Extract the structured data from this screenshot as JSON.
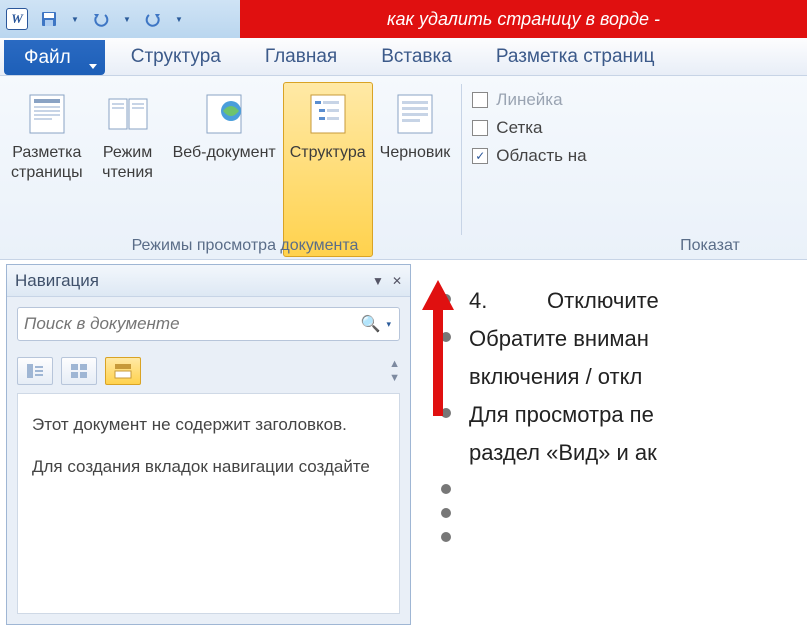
{
  "titlebar": {
    "title": "как удалить страницу в ворде -"
  },
  "tabs": {
    "file": "Файл",
    "items": [
      "Структура",
      "Главная",
      "Вставка",
      "Разметка страниц"
    ]
  },
  "ribbon": {
    "views": [
      {
        "key": "page-layout",
        "label": "Разметка\nстраницы"
      },
      {
        "key": "reading",
        "label": "Режим\nчтения"
      },
      {
        "key": "web",
        "label": "Веб-документ"
      },
      {
        "key": "outline",
        "label": "Структура",
        "selected": true
      },
      {
        "key": "draft",
        "label": "Черновик"
      }
    ],
    "group1_title": "Режимы просмотра документа",
    "checks": {
      "ruler": {
        "label": "Линейка",
        "checked": false,
        "disabled": true
      },
      "grid": {
        "label": "Сетка",
        "checked": false,
        "disabled": false
      },
      "navpane": {
        "label": "Область на",
        "checked": true,
        "disabled": false
      }
    },
    "group2_title": "Показат"
  },
  "nav": {
    "title": "Навигация",
    "search_placeholder": "Поиск в документе",
    "body_p1": "Этот документ не содержит заголовков.",
    "body_p2": "Для создания вкладок навигации создайте"
  },
  "doc": {
    "lines": [
      {
        "num": "4.",
        "text": "Отключите"
      },
      {
        "text": "Обратите вниман"
      },
      {
        "text": "включения / откл"
      },
      {
        "text": "Для просмотра пе"
      },
      {
        "text": "раздел «Вид» и ак"
      }
    ]
  }
}
